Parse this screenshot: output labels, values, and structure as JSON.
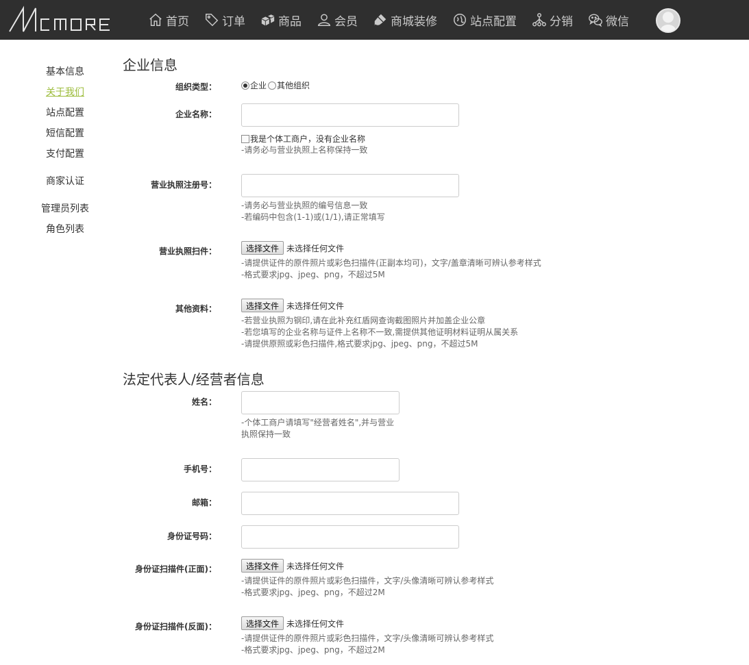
{
  "brand": {
    "logo_text": "MC MORE"
  },
  "nav": [
    {
      "label": "首页",
      "icon": "home-icon"
    },
    {
      "label": "订单",
      "icon": "tag-icon"
    },
    {
      "label": "商品",
      "icon": "boxes-icon"
    },
    {
      "label": "会员",
      "icon": "user-icon"
    },
    {
      "label": "商城装修",
      "icon": "brush-icon"
    },
    {
      "label": "站点配置",
      "icon": "site-config-icon"
    },
    {
      "label": "分销",
      "icon": "network-icon"
    },
    {
      "label": "微信",
      "icon": "wechat-icon"
    }
  ],
  "sidebar": {
    "items": [
      {
        "label": "基本信息"
      },
      {
        "label": "关于我们",
        "active": true
      },
      {
        "label": "站点配置"
      },
      {
        "label": "短信配置"
      },
      {
        "label": "支付配置"
      },
      {
        "label": "商家认证"
      },
      {
        "label": "管理员列表"
      },
      {
        "label": "角色列表"
      }
    ]
  },
  "company": {
    "title": "企业信息",
    "org_type": {
      "label": "组织类型：",
      "options": [
        "企业",
        "其他组织"
      ],
      "selected": "企业"
    },
    "name": {
      "label": "企业名称：",
      "value": "",
      "checkbox_label": "我是个体工商户，没有企业名称",
      "hint": "-请务必与营业执照上名称保持一致"
    },
    "license_no": {
      "label": "营业执照注册号：",
      "value": "",
      "hint1": "-请务必与营业执照的编号信息一致",
      "hint2": "-若编码中包含(1-1)或(1/1),请正常填写"
    },
    "license_scan": {
      "label": "营业执照扫件：",
      "button": "选择文件",
      "status": "未选择任何文件",
      "hint1": "-请提供证件的原件照片或彩色扫描件(正副本均可)，文字/盖章清晰可辨认参考样式",
      "hint2": "-格式要求jpg、jpeg、png，不超过5M"
    },
    "other_docs": {
      "label": "其他资料：",
      "button": "选择文件",
      "status": "未选择任何文件",
      "hint1": "-若营业执照为钢印,请在此补充红盾网查询截图照片并加盖企业公章",
      "hint2": "-若您填写的企业名称与证件上名称不一致,需提供其他证明材料证明从属关系",
      "hint3": "-请提供原照或彩色扫描件,格式要求jpg、jpeg、png，不超过5M"
    }
  },
  "legal": {
    "title": "法定代表人/经营者信息",
    "name": {
      "label": "姓名：",
      "value": "",
      "hint": "-个体工商户请填写\"经营者姓名\",并与营业执照保持一致"
    },
    "phone": {
      "label": "手机号：",
      "value": ""
    },
    "email": {
      "label": "邮箱：",
      "value": ""
    },
    "id_no": {
      "label": "身份证号码：",
      "value": ""
    },
    "id_front": {
      "label": "身份证扫描件(正面)：",
      "button": "选择文件",
      "status": "未选择任何文件",
      "hint1": "-请提供证件的原件照片或彩色扫描件，文字/头像清晰可辨认参考样式",
      "hint2": "-格式要求jpg、jpeg、png，不超过2M"
    },
    "id_back": {
      "label": "身份证扫描件(反面)：",
      "button": "选择文件",
      "status": "未选择任何文件",
      "hint1": "-请提供证件的原件照片或彩色扫描件，文字/头像清晰可辨认参考样式",
      "hint2": "-格式要求jpg、jpeg、png，不超过2M"
    }
  },
  "colors": {
    "topbar": "#2f2f2f",
    "nav_text": "#c9c9c9",
    "active_link": "#9cbc3b"
  }
}
